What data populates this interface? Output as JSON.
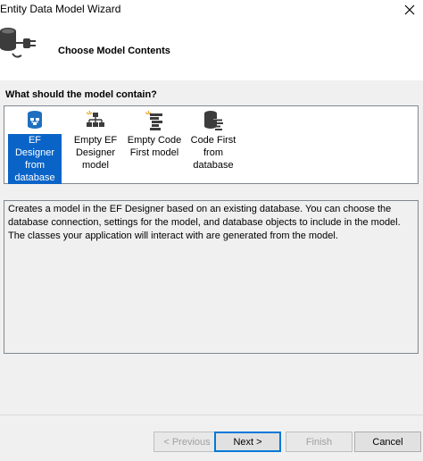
{
  "window": {
    "title": "Entity Data Model Wizard"
  },
  "header": {
    "title": "Choose Model Contents"
  },
  "question": "What should the model contain?",
  "options": [
    {
      "line1": "EF Designer",
      "line2": "from",
      "line3": "database",
      "icon": "database-diagram-icon",
      "selected": true
    },
    {
      "line1": "Empty EF",
      "line2": "Designer",
      "line3": "model",
      "icon": "empty-designer-icon",
      "selected": false
    },
    {
      "line1": "Empty Code",
      "line2": "First model",
      "line3": "",
      "icon": "empty-code-first-icon",
      "selected": false
    },
    {
      "line1": "Code First",
      "line2": "from",
      "line3": "database",
      "icon": "code-first-database-icon",
      "selected": false
    }
  ],
  "description": "Creates a model in the EF Designer based on an existing database. You can choose the database connection, settings for the model, and database objects to include in the model. The classes your application will interact with are generated from the model.",
  "buttons": {
    "previous": "< Previous",
    "next": "Next >",
    "finish": "Finish",
    "cancel": "Cancel"
  },
  "colors": {
    "selection": "#0a64c8",
    "background": "#f0f0f0",
    "accent": "#0078d7"
  }
}
